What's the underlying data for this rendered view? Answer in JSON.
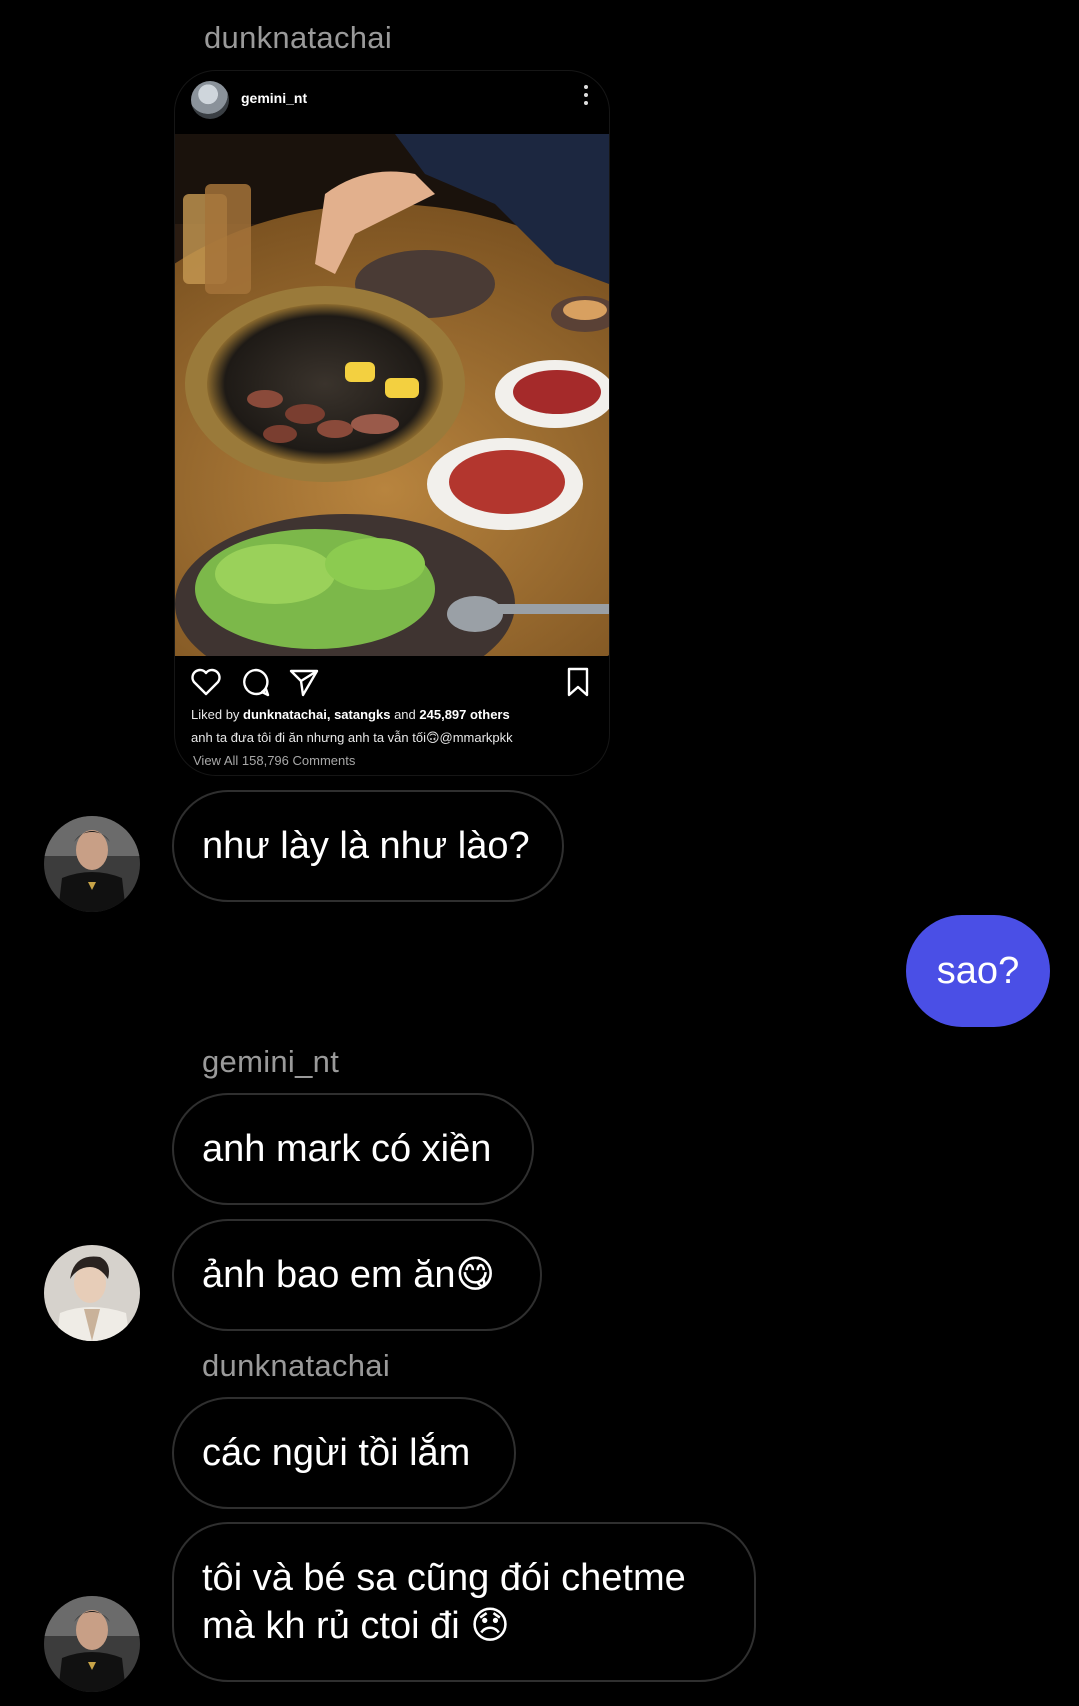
{
  "thread": {
    "sender_dunk_1": "dunknatachai",
    "shared_post": {
      "username": "gemini_nt",
      "liked_prefix": "Liked by",
      "liked_names": "dunknatachai, satangks",
      "liked_and": "and",
      "liked_count": "245,897 others",
      "caption": "anh ta đưa tôi đi ăn nhưng anh ta vẫn tối🙃@mmarkpkk",
      "comments_link": "View All 158,796 Comments"
    },
    "msg_1": "như lày là như lào?",
    "msg_outgoing": "sao?",
    "sender_gemini": "gemini_nt",
    "msg_2": "anh mark có xiền",
    "msg_3": "ảnh bao em ăn😋",
    "sender_dunk_2": "dunknatachai",
    "msg_4": "các ngừi tồi lắm",
    "msg_5_line1": "tôi và bé sa cũng đói chetme",
    "msg_5_line2": "mà kh rủ ctoi đi 😞"
  },
  "colors": {
    "background": "#000000",
    "outgoing_bubble": "#4a4fe6",
    "incoming_border": "#2f2f2f",
    "sender_label": "#9a9a9a"
  },
  "icons": [
    "more-icon",
    "heart-icon",
    "comment-icon",
    "share-icon",
    "bookmark-icon"
  ]
}
